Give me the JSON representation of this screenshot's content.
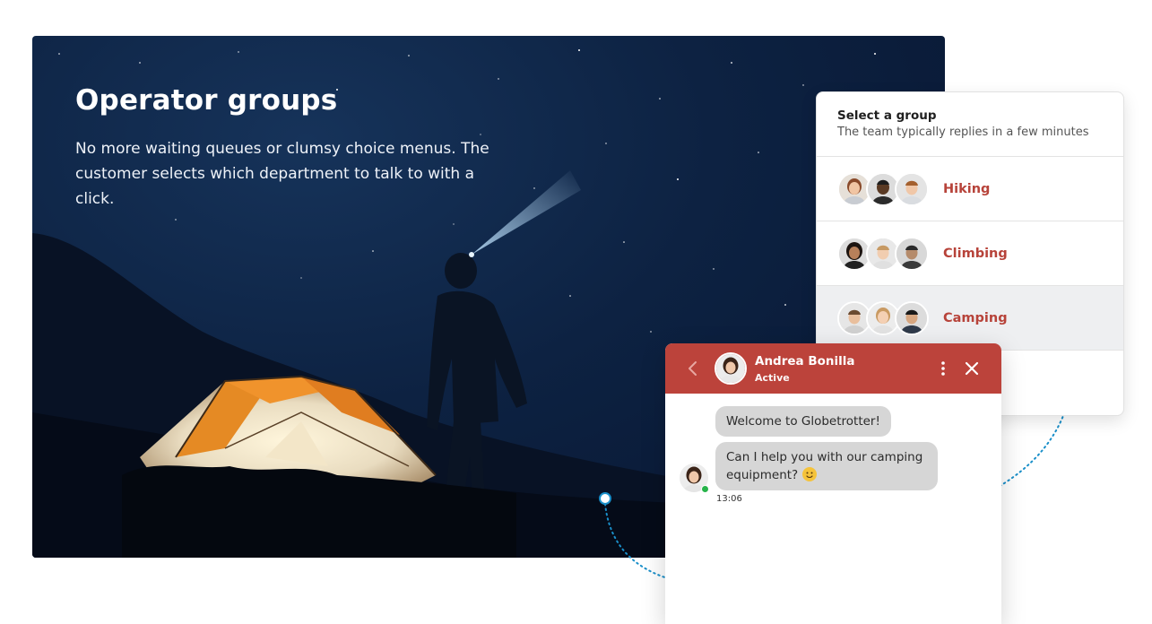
{
  "hero": {
    "title": "Operator groups",
    "description": "No more waiting queues or clumsy choice menus. The customer selects which department to talk to with a click."
  },
  "group_selector": {
    "title": "Select a group",
    "subtitle": "The team typically replies in a few minutes",
    "groups": [
      {
        "name": "Hiking",
        "selected": false
      },
      {
        "name": "Climbing",
        "selected": false
      },
      {
        "name": "Camping",
        "selected": true
      }
    ]
  },
  "chat": {
    "agent_name": "Andrea Bonilla",
    "agent_status": "Active",
    "messages": [
      {
        "text": "Welcome to Globetrotter!"
      },
      {
        "text": "Can I help you with our camping equipment?",
        "emoji": "slightly-smiling-face-icon"
      }
    ],
    "timestamp": "13:06"
  },
  "colors": {
    "accent": "#bc433b",
    "group_label": "#b7433a",
    "connector": "#1a8fc9",
    "online": "#27b44a"
  }
}
